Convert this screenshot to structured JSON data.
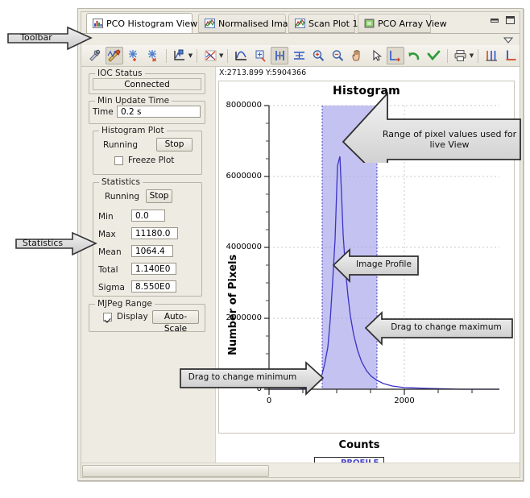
{
  "window": {
    "tabs": [
      {
        "label": "PCO Histogram View",
        "selected": true,
        "icon": "histogram-icon",
        "closable": true
      },
      {
        "label": "Normalised Image",
        "selected": false,
        "icon": "image-plot-icon",
        "closable": false
      },
      {
        "label": "Scan Plot 1",
        "selected": false,
        "icon": "image-plot-icon",
        "closable": false
      },
      {
        "label": "PCO Array View",
        "selected": false,
        "icon": "array-view-icon",
        "closable": false
      }
    ],
    "minimize_label": "Minimize",
    "maximize_label": "Maximize",
    "view_menu_label": "View Menu"
  },
  "toolbar": {
    "items": [
      {
        "name": "configure-settings-icon",
        "pressed": false,
        "dropdown": false
      },
      {
        "name": "plot-tools-icon",
        "pressed": true,
        "dropdown": false
      },
      {
        "name": "add-trace-icon",
        "pressed": false,
        "dropdown": false
      },
      {
        "name": "remove-trace-icon",
        "pressed": false,
        "dropdown": false
      },
      {
        "name": "axis-config-icon",
        "pressed": false,
        "dropdown": true
      },
      {
        "name": "plot-style-icon",
        "pressed": false,
        "dropdown": true
      },
      {
        "name": "fit-curve-icon",
        "pressed": false,
        "dropdown": false
      },
      {
        "name": "zoom-region-icon",
        "pressed": false,
        "dropdown": false
      },
      {
        "name": "vertical-markers-icon",
        "pressed": true,
        "dropdown": false
      },
      {
        "name": "horizontal-markers-icon",
        "pressed": false,
        "dropdown": false
      },
      {
        "name": "zoom-in-icon",
        "pressed": false,
        "dropdown": false
      },
      {
        "name": "zoom-out-icon",
        "pressed": false,
        "dropdown": false
      },
      {
        "name": "pan-hand-icon",
        "pressed": false,
        "dropdown": false
      },
      {
        "name": "select-pointer-icon",
        "pressed": false,
        "dropdown": false
      },
      {
        "name": "auto-scale-icon",
        "pressed": true,
        "dropdown": false
      },
      {
        "name": "undo-icon",
        "pressed": false,
        "dropdown": false
      },
      {
        "name": "redo-icon",
        "pressed": false,
        "dropdown": false
      },
      {
        "name": "print-icon",
        "pressed": false,
        "dropdown": true
      },
      {
        "name": "y-axis-icon",
        "pressed": false,
        "dropdown": false
      },
      {
        "name": "xy-axis-icon",
        "pressed": false,
        "dropdown": false
      }
    ]
  },
  "panel": {
    "ioc_status": {
      "title": "IOC Status",
      "value": "Connected"
    },
    "min_update_time": {
      "title": "Min Update Time",
      "label": "Time",
      "value": "0.2 s"
    },
    "histogram_plot": {
      "title": "Histogram Plot",
      "state": "Running",
      "button": "Stop",
      "freeze_label": "Freeze Plot",
      "freeze_checked": false
    },
    "statistics": {
      "title": "Statistics",
      "state": "Running",
      "button": "Stop",
      "rows": [
        {
          "label": "Min",
          "value": "0.0"
        },
        {
          "label": "Max",
          "value": "11180.0"
        },
        {
          "label": "Mean",
          "value": "1064.4"
        },
        {
          "label": "Total",
          "value": "1.140E0"
        },
        {
          "label": "Sigma",
          "value": "8.550E0"
        }
      ]
    },
    "mjpeg_range": {
      "title": "MJPeg Range",
      "display_label": "Display",
      "display_checked": true,
      "button": "Auto-Scale"
    }
  },
  "chart_readout": "X:2713.899 Y:5904366",
  "chart_data": {
    "type": "line",
    "title": "Histogram",
    "xlabel": "Counts",
    "ylabel": "Number of Pixels",
    "xlim": [
      0,
      3200
    ],
    "ylim": [
      0,
      8600000
    ],
    "xticks": [
      0,
      2000
    ],
    "xtick_labels": [
      "0",
      "2000"
    ],
    "yticks": [
      0,
      2000000,
      4000000,
      6000000,
      8000000
    ],
    "ytick_labels": [
      "0",
      "2000000",
      "4000000",
      "6000000",
      "8000000"
    ],
    "grid": true,
    "legend": {
      "position": "below",
      "entries": [
        {
          "name": "PROFILE",
          "color": "#6a63d8"
        }
      ]
    },
    "series": [
      {
        "name": "PROFILE",
        "color": "#3b32c4",
        "x": [
          0,
          250,
          400,
          520,
          600,
          660,
          700,
          740,
          780,
          820,
          860,
          900,
          940,
          980,
          1010,
          1040,
          1070,
          1100,
          1140,
          1180,
          1230,
          1290,
          1360,
          1450,
          1560,
          1700,
          1900,
          2200,
          2700,
          3200
        ],
        "y": [
          0,
          0,
          4000,
          20000,
          60000,
          140000,
          260000,
          420000,
          700000,
          1300000,
          2400000,
          4100000,
          5600000,
          6300000,
          5900000,
          5000000,
          4000000,
          3100000,
          2300000,
          1650000,
          1100000,
          700000,
          420000,
          250000,
          150000,
          90000,
          50000,
          25000,
          10000,
          4000
        ]
      }
    ],
    "selection_band": {
      "label": "Range of pixel values used for live View",
      "color": "#9f9de8",
      "opacity": 0.62,
      "x_min": 900,
      "x_max": 1720
    }
  },
  "callouts": [
    {
      "id": "toolbar",
      "text": "Toolbar",
      "direction": "right"
    },
    {
      "id": "statistics",
      "text": "Statistics",
      "direction": "right"
    },
    {
      "id": "range",
      "text": "Range of pixel values used for\nlive View",
      "direction": "left"
    },
    {
      "id": "profile",
      "text": "Image Profile",
      "direction": "left"
    },
    {
      "id": "maximum",
      "text": "Drag to change maximum",
      "direction": "left"
    },
    {
      "id": "minimum",
      "text": "Drag to change minimum",
      "direction": "right"
    }
  ]
}
